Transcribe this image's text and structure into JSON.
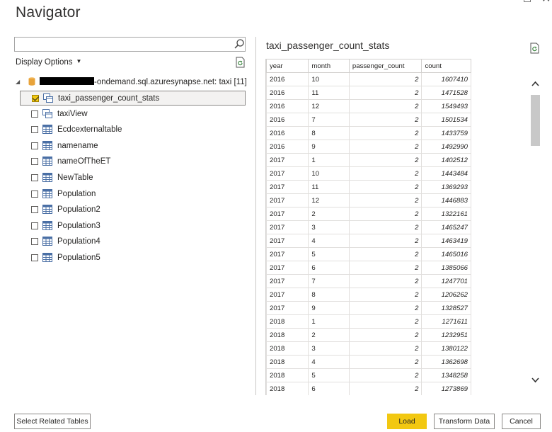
{
  "window": {
    "title": "Navigator"
  },
  "search": {
    "placeholder": "",
    "value": ""
  },
  "display_options": {
    "label": "Display Options"
  },
  "tree": {
    "server_label": "-ondemand.sql.azuresynapse.net: taxi [11]",
    "items": [
      {
        "label": "taxi_passenger_count_stats",
        "checked": true,
        "selected": true,
        "icon": "view-icon"
      },
      {
        "label": "taxiView",
        "checked": false,
        "selected": false,
        "icon": "view-icon"
      },
      {
        "label": "Ecdcexternaltable",
        "checked": false,
        "selected": false,
        "icon": "table-icon"
      },
      {
        "label": "namename",
        "checked": false,
        "selected": false,
        "icon": "table-icon"
      },
      {
        "label": "nameOfTheET",
        "checked": false,
        "selected": false,
        "icon": "table-icon"
      },
      {
        "label": "NewTable",
        "checked": false,
        "selected": false,
        "icon": "table-icon"
      },
      {
        "label": "Population",
        "checked": false,
        "selected": false,
        "icon": "table-icon"
      },
      {
        "label": "Population2",
        "checked": false,
        "selected": false,
        "icon": "table-icon"
      },
      {
        "label": "Population3",
        "checked": false,
        "selected": false,
        "icon": "table-icon"
      },
      {
        "label": "Population4",
        "checked": false,
        "selected": false,
        "icon": "table-icon"
      },
      {
        "label": "Population5",
        "checked": false,
        "selected": false,
        "icon": "table-icon"
      }
    ]
  },
  "preview": {
    "title": "taxi_passenger_count_stats",
    "columns": [
      "year",
      "month",
      "passenger_count",
      "count"
    ],
    "rows": [
      [
        "2016",
        "10",
        "2",
        "1607410"
      ],
      [
        "2016",
        "11",
        "2",
        "1471528"
      ],
      [
        "2016",
        "12",
        "2",
        "1549493"
      ],
      [
        "2016",
        "7",
        "2",
        "1501534"
      ],
      [
        "2016",
        "8",
        "2",
        "1433759"
      ],
      [
        "2016",
        "9",
        "2",
        "1492990"
      ],
      [
        "2017",
        "1",
        "2",
        "1402512"
      ],
      [
        "2017",
        "10",
        "2",
        "1443484"
      ],
      [
        "2017",
        "11",
        "2",
        "1369293"
      ],
      [
        "2017",
        "12",
        "2",
        "1446883"
      ],
      [
        "2017",
        "2",
        "2",
        "1322161"
      ],
      [
        "2017",
        "3",
        "2",
        "1465247"
      ],
      [
        "2017",
        "4",
        "2",
        "1463419"
      ],
      [
        "2017",
        "5",
        "2",
        "1465016"
      ],
      [
        "2017",
        "6",
        "2",
        "1385066"
      ],
      [
        "2017",
        "7",
        "2",
        "1247701"
      ],
      [
        "2017",
        "8",
        "2",
        "1206262"
      ],
      [
        "2017",
        "9",
        "2",
        "1328527"
      ],
      [
        "2018",
        "1",
        "2",
        "1271611"
      ],
      [
        "2018",
        "2",
        "2",
        "1232951"
      ],
      [
        "2018",
        "3",
        "2",
        "1380122"
      ],
      [
        "2018",
        "4",
        "2",
        "1362698"
      ],
      [
        "2018",
        "5",
        "2",
        "1348258"
      ],
      [
        "2018",
        "6",
        "2",
        "1273869"
      ]
    ]
  },
  "buttons": {
    "select_related": "Select Related Tables",
    "load": "Load",
    "transform": "Transform Data",
    "cancel": "Cancel"
  },
  "colors": {
    "accent": "#f2c811",
    "database": "#e8a33b",
    "border": "#8a8886"
  }
}
